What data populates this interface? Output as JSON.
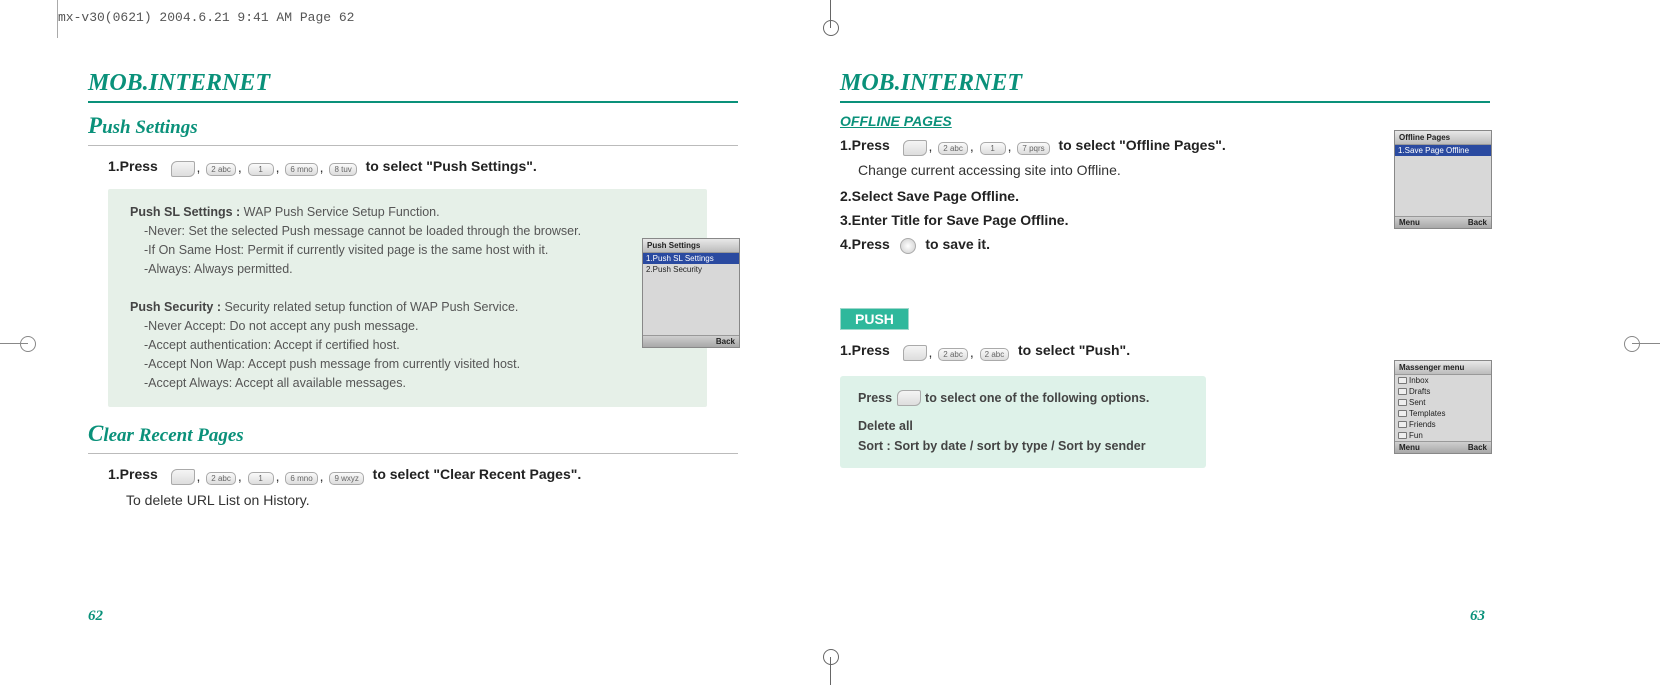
{
  "header": {
    "line": "mx-v30(0621)  2004.6.21  9:41 AM  Page 62"
  },
  "left": {
    "title": "MOB.INTERNET",
    "section1": {
      "heading_cap": "P",
      "heading_rest": "ush Settings",
      "step1_pre": "1.Press",
      "step1_post": "to select \"Push Settings\".",
      "keys": [
        "2 abc",
        "1",
        "6 mno",
        "8 tuv"
      ],
      "note_sl_label": "Push SL Settings :",
      "note_sl_body": " WAP Push Service Setup Function.",
      "note_sl_l1": "-Never: Set the selected Push message cannot be loaded through the browser.",
      "note_sl_l2": "-If On Same Host: Permit if currently visited page is the same host with it.",
      "note_sl_l3": "-Always: Always permitted.",
      "note_sec_label": "Push Security :",
      "note_sec_body": " Security related setup function of WAP Push Service.",
      "note_sec_l1": "-Never Accept: Do not accept any push message.",
      "note_sec_l2": "-Accept authentication: Accept if certified host.",
      "note_sec_l3": "-Accept Non Wap: Accept push message from currently visited host.",
      "note_sec_l4": "-Accept  Always: Accept all available messages."
    },
    "section2": {
      "heading_cap": "C",
      "heading_rest": "lear Recent Pages",
      "step1_pre": "1.Press",
      "step1_post": "to select \"Clear Recent Pages\".",
      "keys": [
        "2 abc",
        "1",
        "6 mno",
        "9 wxyz"
      ],
      "line2": "To delete URL List on History."
    },
    "phone1": {
      "title": "Push Settings",
      "row1": "1.Push SL Settings",
      "row2": "2.Push Security",
      "foot_left": "",
      "foot_right": "Back"
    },
    "pagenum": "62"
  },
  "right": {
    "title": "MOB.INTERNET",
    "section1": {
      "heading": "OFFLINE PAGES",
      "step1_pre": "1.Press",
      "step1_post": "to select \"Offline Pages\".",
      "keys1": [
        "2 abc",
        "1",
        "7 pqrs"
      ],
      "line2": "Change current accessing site into Offline.",
      "step2": "2.Select Save Page Offline.",
      "step3": "3.Enter Title for Save Page Offline.",
      "step4_pre": "4.Press",
      "step4_post": "to save it."
    },
    "section2": {
      "heading": "PUSH",
      "step1_pre": "1.Press",
      "step1_post": "to select \"Push\".",
      "keys": [
        "2 abc",
        "2 abc"
      ],
      "note_line1_pre": "Press",
      "note_line1_post": "to select one of the following options.",
      "note_line2": "Delete all",
      "note_line3": "Sort : Sort by date / sort by type / Sort by sender"
    },
    "phone1": {
      "title": "Offline Pages",
      "row1": "1.Save Page Offline",
      "foot_left": "Menu",
      "foot_right": "Back"
    },
    "phone2": {
      "title": "Massenger menu",
      "items": [
        "Inbox",
        "Drafts",
        "Sent",
        "Templates",
        "Friends",
        "Fun"
      ],
      "foot_left": "Menu",
      "foot_right": "Back"
    },
    "pagenum": "63"
  }
}
